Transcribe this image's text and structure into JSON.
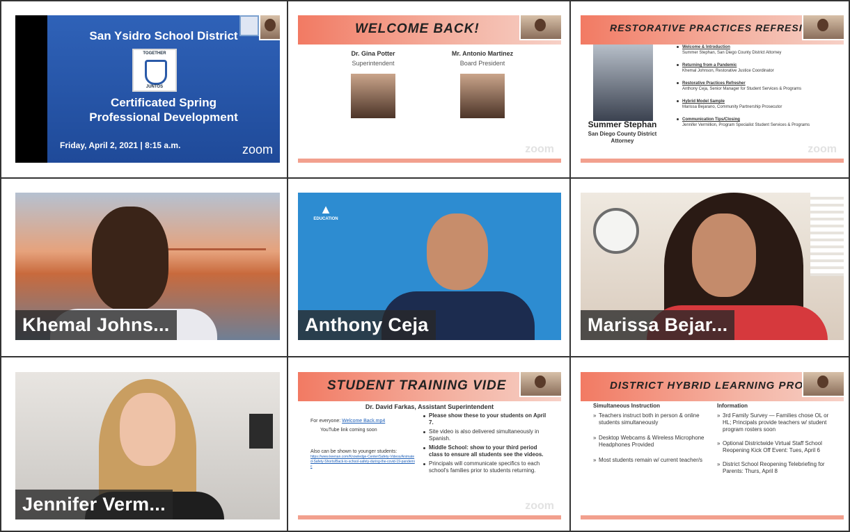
{
  "tiles": {
    "t1": {
      "title": "San Ysidro School District",
      "logo_top": "TOGETHER",
      "logo_bottom": "JUNTOS",
      "subtitle_line1": "Certificated Spring",
      "subtitle_line2": "Professional Development",
      "date": "Friday, April 2, 2021 | 8:15 a.m.",
      "brand": "zoom"
    },
    "t2": {
      "banner": "WELCOME BACK!",
      "people": [
        {
          "name": "Dr. Gina Potter",
          "role": "Superintendent"
        },
        {
          "name": "Mr. Antonio Martinez",
          "role": "Board President"
        }
      ],
      "brand": "zoom"
    },
    "t3": {
      "banner": "RESTORATIVE PRACTICES REFRESI",
      "speaker_name": "Summer Stephan",
      "speaker_title": "San Diego County District Attorney",
      "agenda": [
        {
          "title": "Welcome & Introduction",
          "detail": "Summer Stephan, San Diego County District Attorney"
        },
        {
          "title": "Returning from a Pandemic",
          "detail": "Khemal Johnson, Restorative Justice Coordinator"
        },
        {
          "title": "Restorative Practices Refresher",
          "detail": "Anthony Ceja, Senior Manager for Student Services & Programs"
        },
        {
          "title": "Hybrid Model Sample",
          "detail": "Marissa Bejarano, Community Partnership Prosecutor"
        },
        {
          "title": "Communication Tips/Closing",
          "detail": "Jennifer Vermillion, Program Specialist Student Services & Programs"
        }
      ],
      "brand": "zoom"
    },
    "t4": {
      "participant": "Khemal Johns..."
    },
    "t5": {
      "participant": "Anthony Ceja",
      "logo_text": "EDUCATION"
    },
    "t6": {
      "participant": "Marissa Bejar..."
    },
    "t7": {
      "participant": "Jennifer Verm..."
    },
    "t8": {
      "banner": "STUDENT TRAINING VIDE",
      "subtitle": "Dr. David Farkas, Assistant Superintendent",
      "left": {
        "line1": "For everyone:",
        "line1_link": "Welcome Back.mp4",
        "line2": "YouTube link coming soon",
        "line3": "Also can be shown to younger students:",
        "line3_link": "https://www.keenan.com/Knowledge-Center/Safety-Videos/Animated-Safety-Shorts/Back-to-school-safety-during-the-covid-19-pandemic"
      },
      "bullets": [
        "Please show these to your students on April 7.",
        "Site video is also delivered simultaneously in Spanish.",
        "Middle School: show to your third period class to ensure all students see the videos.",
        "Principals will communicate specifics to each school's families prior to students returning."
      ],
      "brand": "zoom"
    },
    "t9": {
      "banner": "DISTRICT HYBRID LEARNING PROG",
      "left_header": "Simultaneous Instruction",
      "left_items": [
        "Teachers instruct both in person & online students simultaneously",
        "Desktop Webcams & Wireless Microphone Headphones Provided",
        "Most students remain w/ current teacher/s"
      ],
      "right_header": "Information",
      "right_items": [
        "3rd Family Survey — Families chose OL or HL; Principals provide teachers w/ student program rosters soon",
        "Optional Districtwide Virtual Staff School Reopening Kick Off Event: Tues, April 6",
        "District School Reopening Telebriefing for Parents: Thurs, April 8"
      ]
    }
  }
}
